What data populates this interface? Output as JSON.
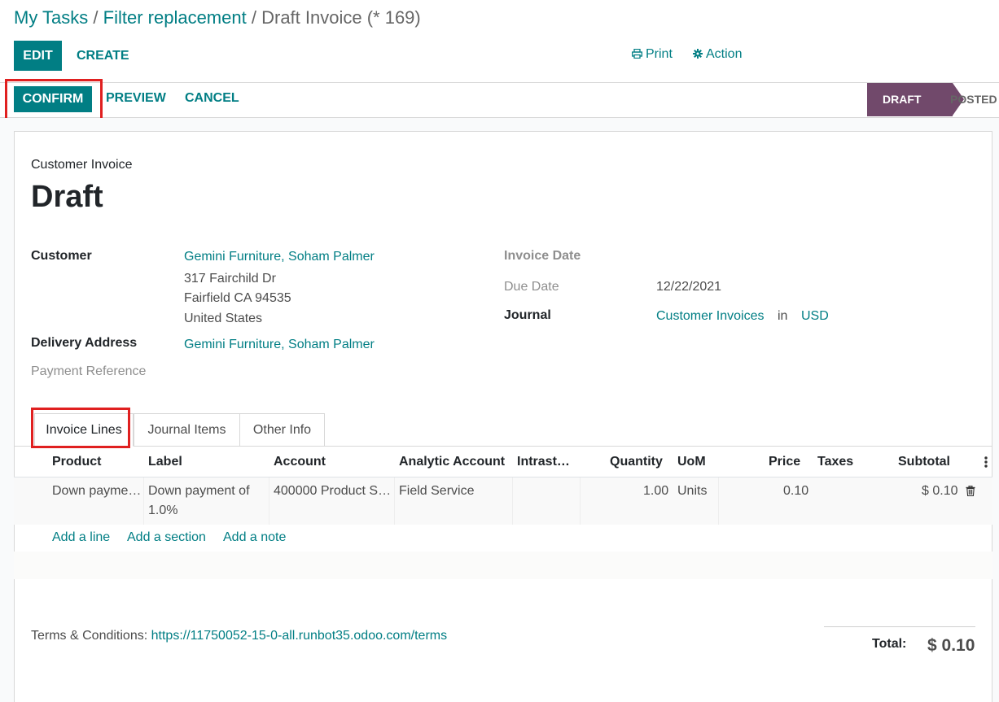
{
  "breadcrumb": {
    "items": [
      "My Tasks",
      "Filter replacement",
      "Draft Invoice (* 169)"
    ],
    "separator": "/"
  },
  "control_panel": {
    "edit_label": "EDIT",
    "create_label": "CREATE",
    "print_label": "Print",
    "action_label": "Action"
  },
  "statusbar": {
    "confirm_label": "CONFIRM",
    "preview_label": "PREVIEW",
    "cancel_label": "CANCEL",
    "stages": [
      "DRAFT",
      "POSTED"
    ],
    "active_stage": "DRAFT"
  },
  "invoice": {
    "type_label": "Customer Invoice",
    "title": "Draft",
    "customer_label": "Customer",
    "customer_name": "Gemini Furniture, Soham Palmer",
    "address_line1": "317 Fairchild Dr",
    "address_line2": "Fairfield CA 94535",
    "address_line3": "United States",
    "delivery_label": "Delivery Address",
    "delivery_value": "Gemini Furniture, Soham Palmer",
    "payment_ref_label": "Payment Reference",
    "invoice_date_label": "Invoice Date",
    "due_date_label": "Due Date",
    "due_date_value": "12/22/2021",
    "journal_label": "Journal",
    "journal_value": "Customer Invoices",
    "journal_in": "in",
    "currency": "USD"
  },
  "tabs": [
    "Invoice Lines",
    "Journal Items",
    "Other Info"
  ],
  "table": {
    "columns": [
      "Product",
      "Label",
      "Account",
      "Analytic Account",
      "Intrast…",
      "Quantity",
      "UoM",
      "Price",
      "Taxes",
      "Subtotal"
    ],
    "rows": [
      {
        "product": "Down payme…",
        "label_line1": "Down payment of",
        "label_line2": "1.0%",
        "account": "400000 Product S…",
        "analytic": "Field Service",
        "intrastat": "",
        "quantity": "1.00",
        "uom": "Units",
        "price": "0.10",
        "taxes": "",
        "subtotal": "$ 0.10"
      }
    ],
    "add_links": [
      "Add a line",
      "Add a section",
      "Add a note"
    ]
  },
  "footer": {
    "terms_label": "Terms & Conditions:",
    "terms_url": "https://11750052-15-0-all.runbot35.odoo.com/terms",
    "total_label": "Total:",
    "total_value": "$ 0.10"
  },
  "colors": {
    "primary": "#017e84",
    "stage_active": "#71496b",
    "highlight": "#e02020"
  }
}
